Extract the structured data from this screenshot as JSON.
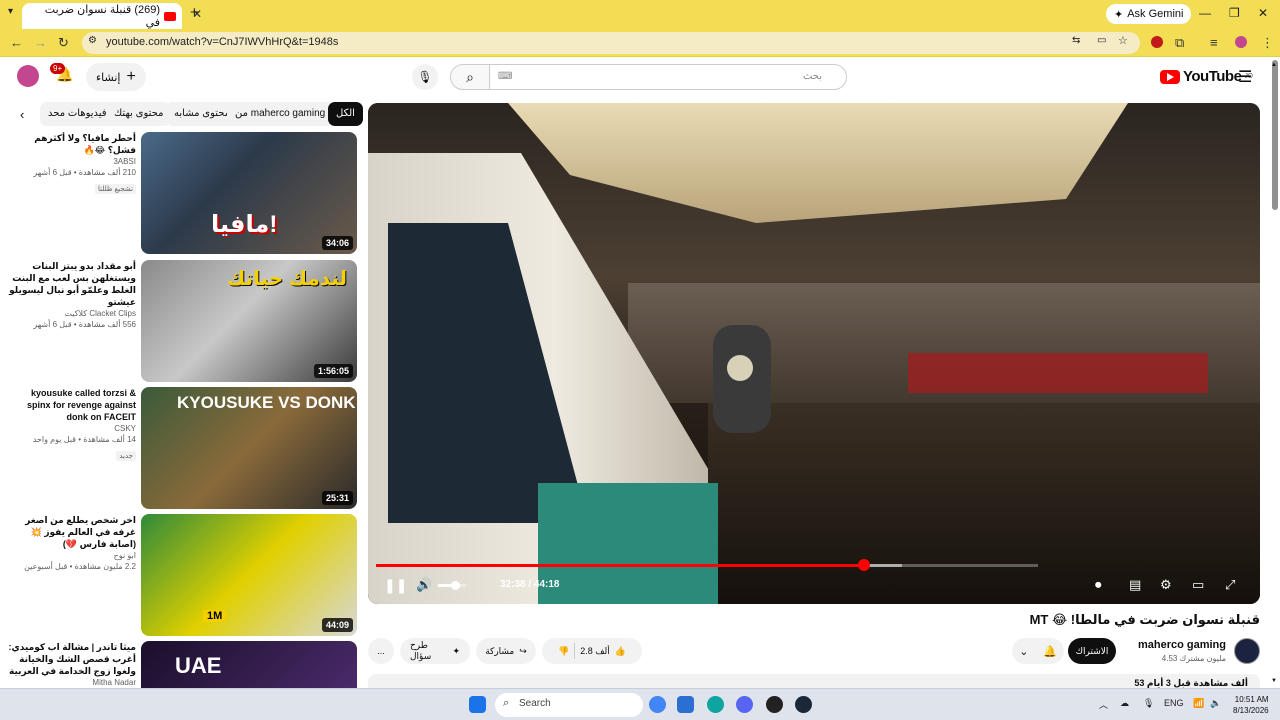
{
  "browser": {
    "tab_title": "(269) قنبلة نسوان ضربت في",
    "ask_gemini": "Ask Gemini",
    "url": "youtube.com/watch?v=CnJ7IWVhHrQ&t=1948s"
  },
  "header": {
    "search_placeholder": "بحث",
    "create_label": "إنشاء",
    "notifications_count": "9+",
    "logo_text": "YouTube",
    "logo_region": "JO"
  },
  "chips": [
    "الكل",
    "من maherco gaming",
    "محتوى مشابه",
    "محتوى بهتك",
    "فيديوهات محد..."
  ],
  "recommendations": [
    {
      "title": "أحطر مافيا؟ ولا أكثرهم فشل؟ 😂🔥",
      "channel": "3ABSI",
      "views": "210 ألف مشاهدة • قبل 6 أشهر",
      "badge": "تشجيع ظللتا",
      "duration": "34:06",
      "thumb_text": "مافيا!"
    },
    {
      "title": "أبو مقداد بدو يبتز البنات ويستغلهن بس لعب مع البنت الغلط وعلمّو أبو نبال ليسويلو عيشتو",
      "channel": "Clacket Clips كلاكيت",
      "views": "556 ألف مشاهدة • قبل 6 أشهر",
      "badge": "",
      "duration": "1:56:05",
      "thumb_text": "لندمك حياتك"
    },
    {
      "title": "kyousuke called torzsi & spinx for revenge against donk on FACEIT",
      "channel": "CSKY",
      "views": "14 ألف مشاهدة • قبل يوم واحد",
      "badge": "جديد",
      "duration": "25:31",
      "thumb_text": "KYOUSUKE VS DONK"
    },
    {
      "title": "اخر شخص يطلع من اصغر غرفه في العالم يفوز 💥 (اصابة فارس 💔)",
      "channel": "ابو نوح",
      "views": "2.2 مليون مشاهدة • قبل أسبوعين",
      "badge": "",
      "duration": "44:09",
      "thumb_text": "1M"
    },
    {
      "title": "ميثا تاندر | مشالة اب كوميدي: أغرب قصص الشك والخيانة ولغوا زوج الخدامة في العربية",
      "channel": "Mitha Nadar",
      "views": "",
      "badge": "",
      "duration": "",
      "thumb_text": "UAE"
    }
  ],
  "player": {
    "time_current": "32:38",
    "time_total": "44:18",
    "time_display": "32:38 / 44:18",
    "progress_fraction": 0.7367,
    "buffer_fraction": 0.794,
    "volume_fraction": 0.6
  },
  "video": {
    "title": "قنبلة نسوان ضربت في مالطا! 😂 MT",
    "channel": "maherco gaming",
    "subscribers": "4.53 مليون مشترك",
    "subscribe_label": "الاشتراك",
    "likes": "2.8 ألف",
    "share_label": "مشاركة",
    "ask_label": "طرح سؤال",
    "more_label": "...",
    "next_text": "53 ألف مشاهدة قبل 3 أيام"
  },
  "taskbar": {
    "search_placeholder": "Search",
    "language": "ENG",
    "time": "10:51 AM",
    "date": "8/13/2026"
  },
  "colors": {
    "browser_chrome": "#f2dd54",
    "yt_red": "#ff0000",
    "progress": "#ff0000"
  }
}
